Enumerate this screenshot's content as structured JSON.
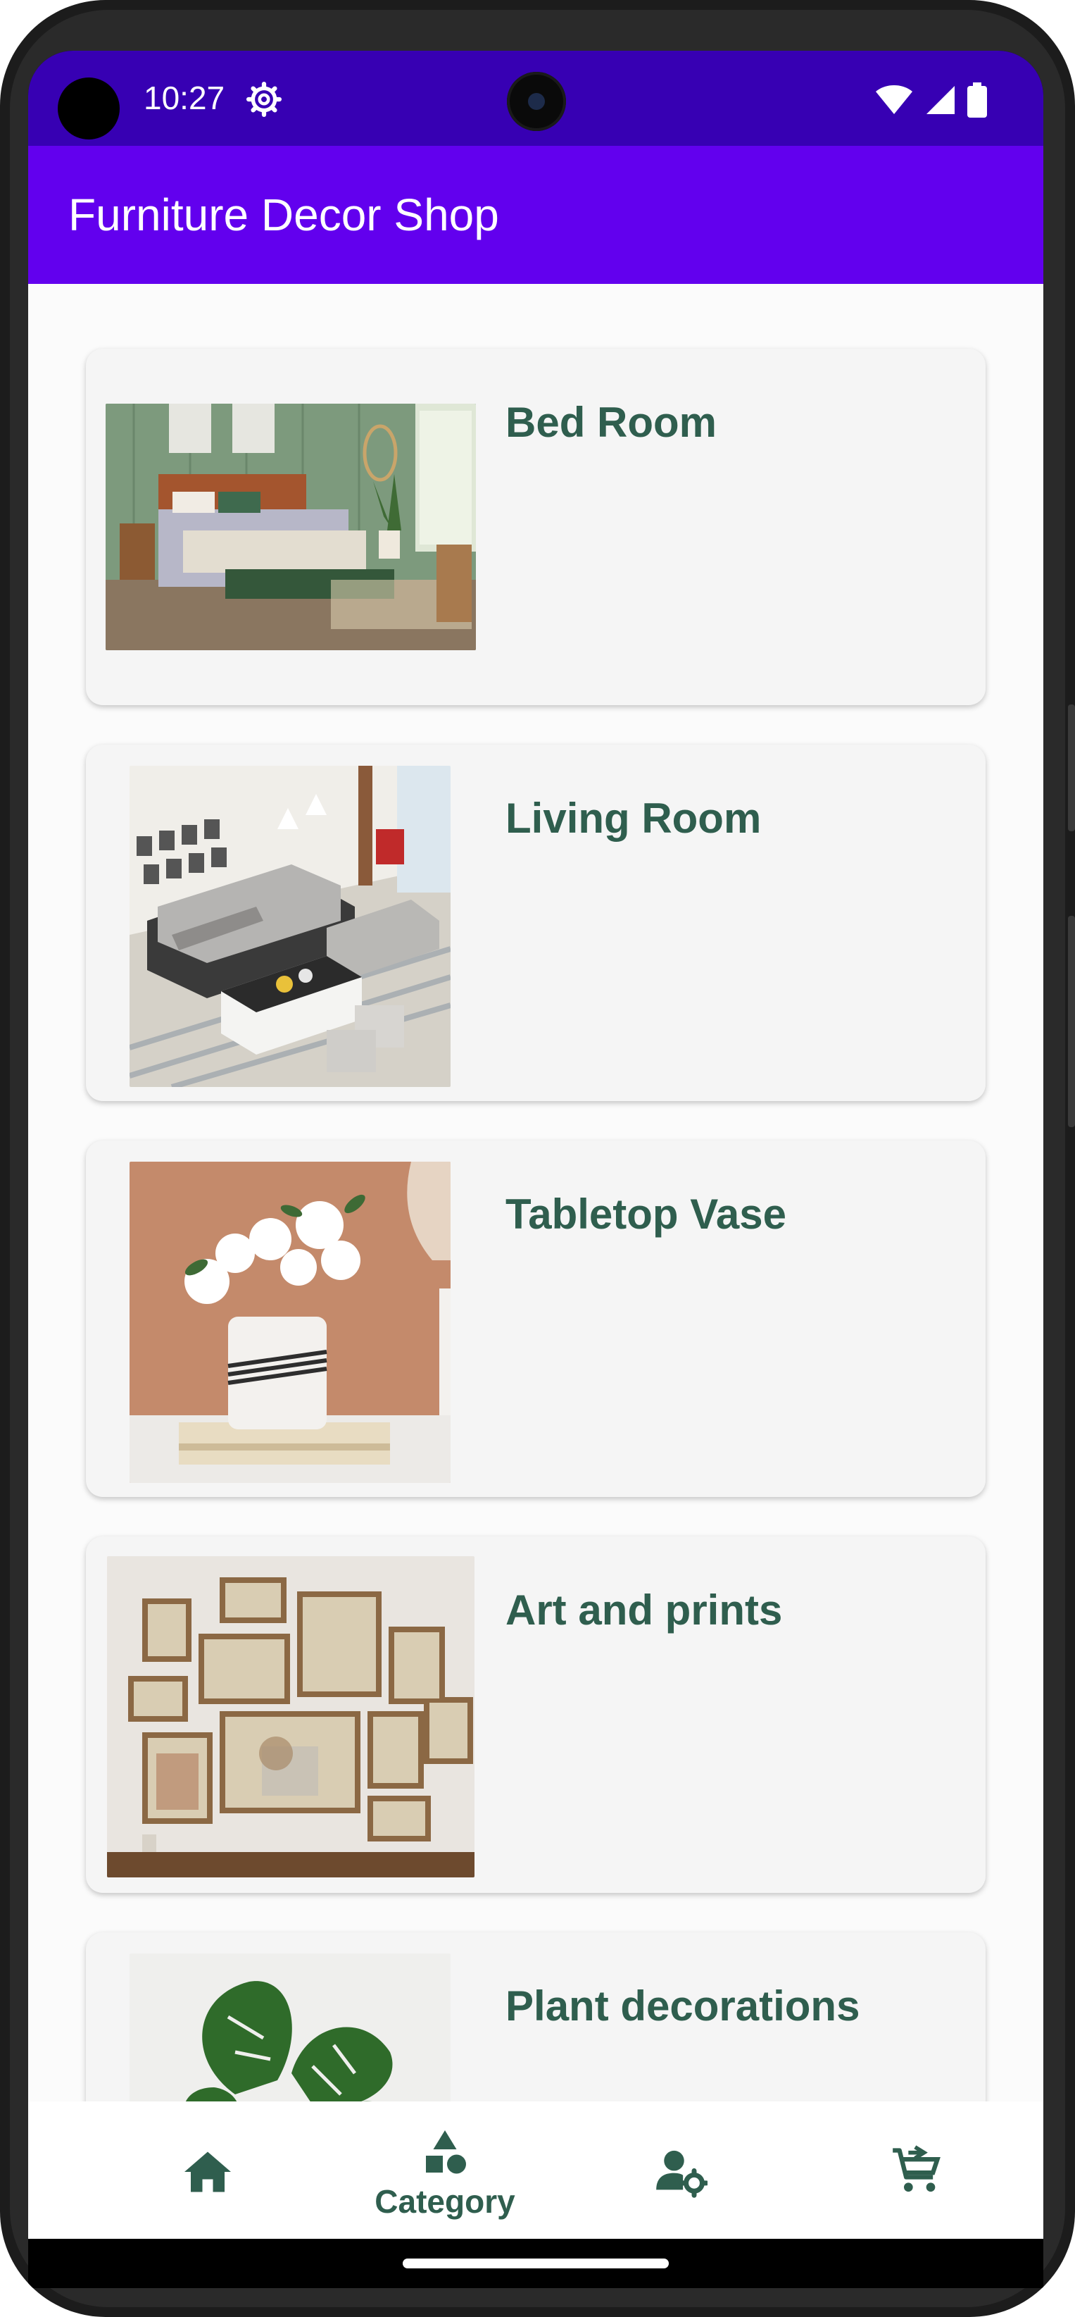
{
  "status_bar": {
    "time": "10:27",
    "icons": [
      "gear-icon",
      "wifi-icon",
      "signal-icon",
      "battery-icon"
    ],
    "background": "#3700b3"
  },
  "app_bar": {
    "title": "Furniture Decor Shop",
    "background": "#6200ee"
  },
  "categories": [
    {
      "title": "Bed Room",
      "image": "bed-room-image"
    },
    {
      "title": "Living Room",
      "image": "living-room-image"
    },
    {
      "title": "Tabletop Vase",
      "image": "tabletop-vase-image"
    },
    {
      "title": "Art and prints",
      "image": "art-prints-image"
    },
    {
      "title": "Plant decorations",
      "image": "plant-decorations-image"
    }
  ],
  "bottom_nav": {
    "items": [
      {
        "icon": "home-icon",
        "label": ""
      },
      {
        "icon": "category-icon",
        "label": "Category",
        "selected": true
      },
      {
        "icon": "admin-settings-icon",
        "label": ""
      },
      {
        "icon": "cart-icon",
        "label": ""
      }
    ],
    "accent": "#2f5e4e"
  }
}
